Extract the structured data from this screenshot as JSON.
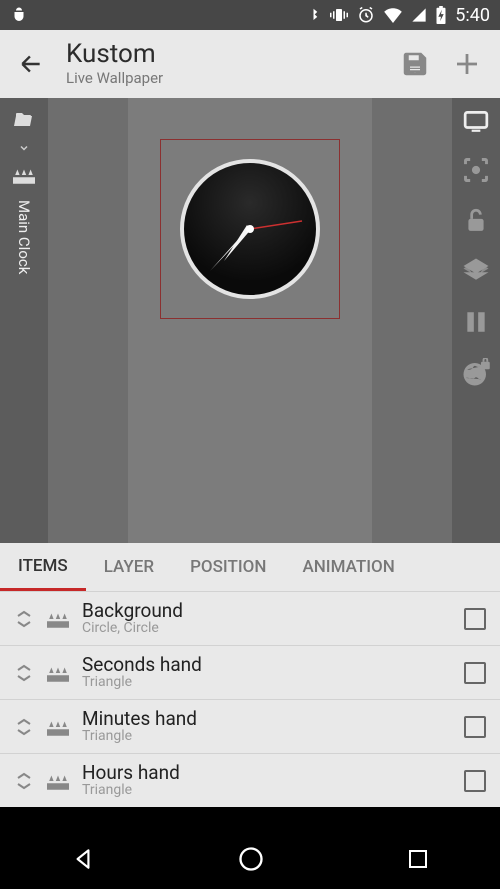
{
  "status": {
    "time": "5:40"
  },
  "header": {
    "title": "Kustom",
    "subtitle": "Live Wallpaper"
  },
  "sidebar": {
    "label": "Main Clock"
  },
  "tabs": {
    "items": [
      {
        "label": "ITEMS",
        "active": true
      },
      {
        "label": "LAYER",
        "active": false
      },
      {
        "label": "POSITION",
        "active": false
      },
      {
        "label": "ANIMATION",
        "active": false
      }
    ]
  },
  "list": {
    "items": [
      {
        "title": "Background",
        "subtitle": "Circle, Circle"
      },
      {
        "title": "Seconds hand",
        "subtitle": "Triangle"
      },
      {
        "title": "Minutes hand",
        "subtitle": "Triangle"
      },
      {
        "title": "Hours hand",
        "subtitle": "Triangle"
      }
    ]
  }
}
